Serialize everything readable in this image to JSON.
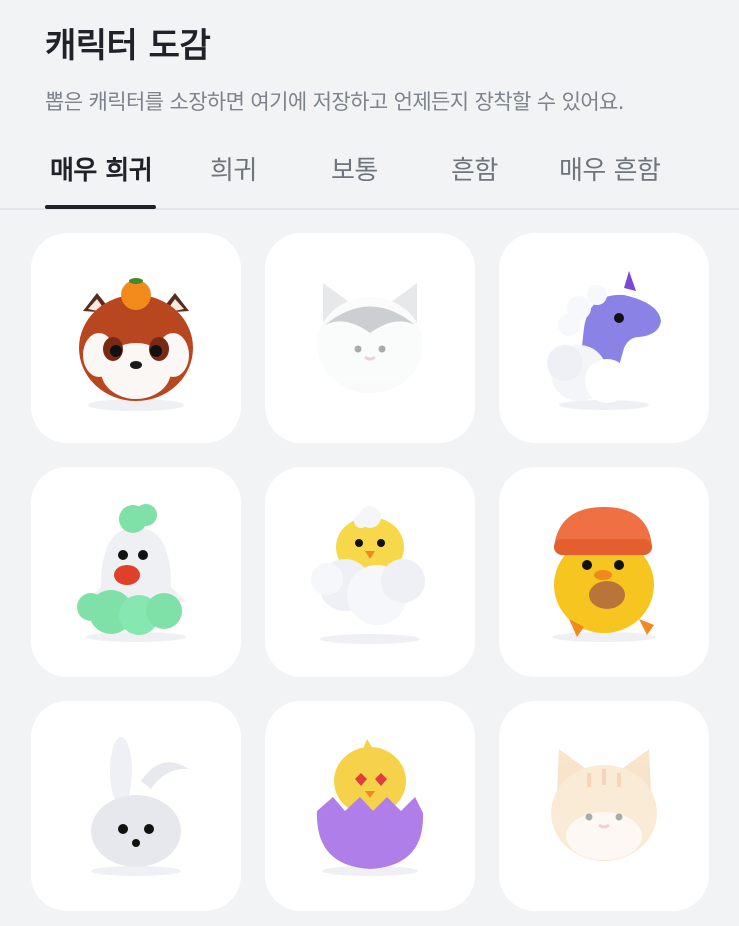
{
  "header": {
    "title": "캐릭터 도감",
    "subtitle": "뽑은 캐릭터를 소장하면 여기에 저장하고 언제든지 장착할 수 있어요."
  },
  "tabs": [
    {
      "label": "매우 희귀",
      "active": true
    },
    {
      "label": "희귀",
      "active": false
    },
    {
      "label": "보통",
      "active": false
    },
    {
      "label": "흔함",
      "active": false
    },
    {
      "label": "매우 흔함",
      "active": false
    }
  ],
  "characters": [
    {
      "icon": "red-panda-with-tangerine-icon",
      "collected": true
    },
    {
      "icon": "white-cat-icon",
      "collected": false
    },
    {
      "icon": "purple-unicorn-icon",
      "collected": true
    },
    {
      "icon": "ghost-with-green-cloud-icon",
      "collected": true
    },
    {
      "icon": "chick-on-cloud-icon",
      "collected": true
    },
    {
      "icon": "chick-with-beanie-and-taiyaki-icon",
      "collected": true
    },
    {
      "icon": "white-bunny-icon",
      "collected": true
    },
    {
      "icon": "chick-in-purple-egg-icon",
      "collected": true
    },
    {
      "icon": "orange-tabby-cat-icon",
      "collected": false
    }
  ],
  "colors": {
    "background": "#f2f3f5",
    "card": "#ffffff",
    "text_primary": "#1f2329",
    "text_secondary": "#7d838c"
  }
}
